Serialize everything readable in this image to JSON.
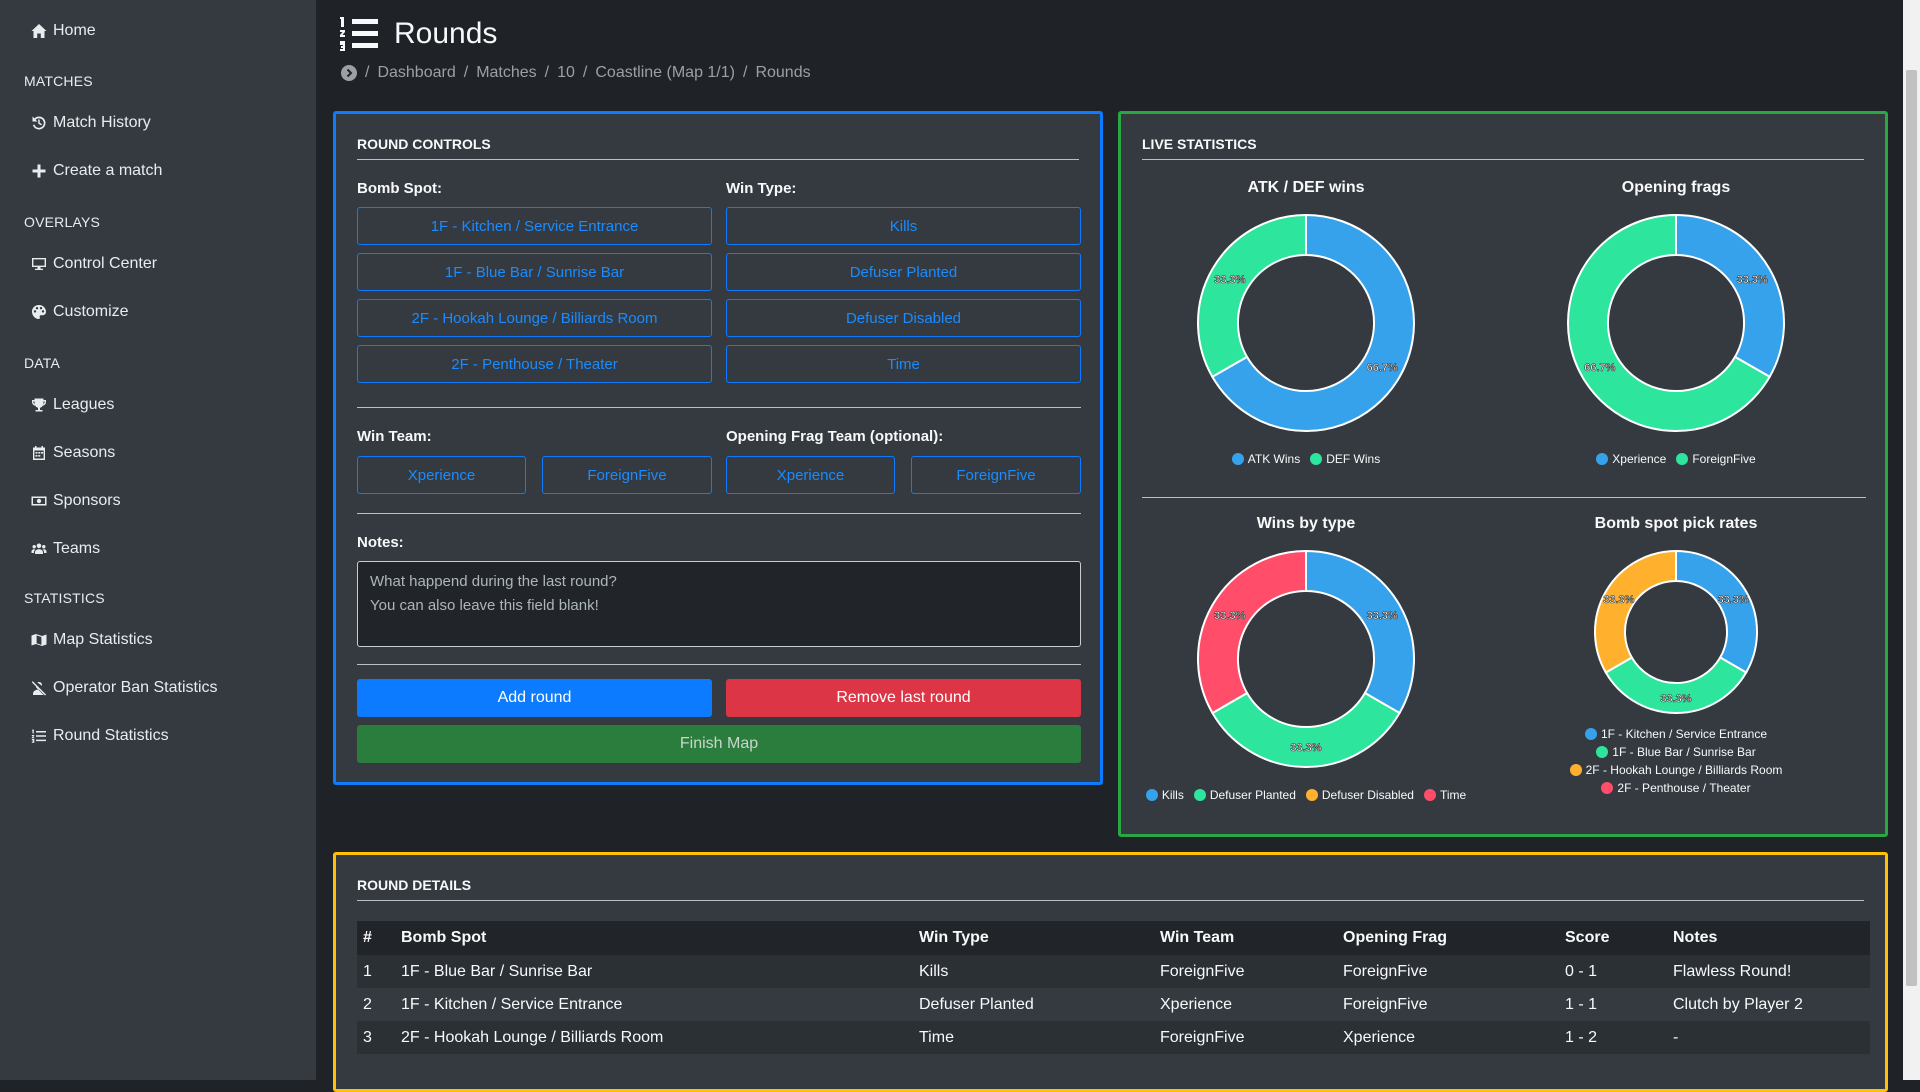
{
  "sidebar": {
    "home": "Home",
    "sections": [
      {
        "heading": "MATCHES",
        "items": [
          "Match History",
          "Create a match"
        ]
      },
      {
        "heading": "OVERLAYS",
        "items": [
          "Control Center",
          "Customize"
        ]
      },
      {
        "heading": "DATA",
        "items": [
          "Leagues",
          "Seasons",
          "Sponsors",
          "Teams"
        ]
      },
      {
        "heading": "STATISTICS",
        "items": [
          "Map Statistics",
          "Operator Ban Statistics",
          "Round Statistics"
        ]
      }
    ]
  },
  "header": {
    "title": "Rounds",
    "breadcrumb": [
      "Dashboard",
      "Matches",
      "10",
      "Coastline (Map 1/1)",
      "Rounds"
    ]
  },
  "controls": {
    "title": "ROUND CONTROLS",
    "bomb_spot_label": "Bomb Spot:",
    "bomb_spots": [
      "1F - Kitchen / Service Entrance",
      "1F - Blue Bar / Sunrise Bar",
      "2F - Hookah Lounge / Billiards Room",
      "2F - Penthouse / Theater"
    ],
    "win_type_label": "Win Type:",
    "win_types": [
      "Kills",
      "Defuser Planted",
      "Defuser Disabled",
      "Time"
    ],
    "win_team_label": "Win Team:",
    "win_teams": [
      "Xperience",
      "ForeignFive"
    ],
    "opening_frag_label": "Opening Frag Team (optional):",
    "opening_frag_teams": [
      "Xperience",
      "ForeignFive"
    ],
    "notes_label": "Notes:",
    "notes_placeholder": "What happend during the last round?\nYou can also leave this field blank!",
    "add_round": "Add round",
    "remove_last_round": "Remove last round",
    "finish_map": "Finish Map"
  },
  "stats": {
    "title": "LIVE STATISTICS",
    "charts": [
      {
        "title": "ATK / DEF wins",
        "legend": [
          "ATK Wins",
          "DEF Wins"
        ],
        "values": [
          66.7,
          33.3
        ],
        "labels": [
          "66.7%",
          "33.3%"
        ],
        "colors": [
          "#36a2eb",
          "#2ee59d"
        ]
      },
      {
        "title": "Opening frags",
        "legend": [
          "Xperience",
          "ForeignFive"
        ],
        "values": [
          33.3,
          66.7
        ],
        "labels": [
          "33.3%",
          "66.7%"
        ],
        "colors": [
          "#36a2eb",
          "#2ee59d"
        ]
      },
      {
        "title": "Wins by type",
        "legend": [
          "Kills",
          "Defuser Planted",
          "Defuser Disabled",
          "Time"
        ],
        "values": [
          33.3,
          33.3,
          0,
          33.3
        ],
        "labels": [
          "33.3%",
          "33.3%",
          "",
          "33.3%"
        ],
        "colors": [
          "#36a2eb",
          "#2ee59d",
          "#ffb12e",
          "#ff4d6a"
        ]
      },
      {
        "title": "Bomb spot pick rates",
        "legend": [
          "1F - Kitchen / Service Entrance",
          "1F - Blue Bar / Sunrise Bar",
          "2F - Hookah Lounge / Billiards Room",
          "2F - Penthouse / Theater"
        ],
        "values": [
          33.3,
          33.3,
          33.3,
          0
        ],
        "labels": [
          "33.3%",
          "33.3%",
          "33.3%",
          ""
        ],
        "colors": [
          "#36a2eb",
          "#2ee59d",
          "#ffb12e",
          "#ff4d6a"
        ]
      }
    ]
  },
  "details": {
    "title": "ROUND DETAILS",
    "columns": [
      "#",
      "Bomb Spot",
      "Win Type",
      "Win Team",
      "Opening Frag",
      "Score",
      "Notes"
    ],
    "rows": [
      [
        "1",
        "1F - Blue Bar / Sunrise Bar",
        "Kills",
        "ForeignFive",
        "ForeignFive",
        "0 - 1",
        "Flawless Round!"
      ],
      [
        "2",
        "1F - Kitchen / Service Entrance",
        "Defuser Planted",
        "Xperience",
        "ForeignFive",
        "1 - 1",
        "Clutch by Player 2"
      ],
      [
        "3",
        "2F - Hookah Lounge / Billiards Room",
        "Time",
        "ForeignFive",
        "Xperience",
        "1 - 2",
        "-"
      ]
    ]
  }
}
